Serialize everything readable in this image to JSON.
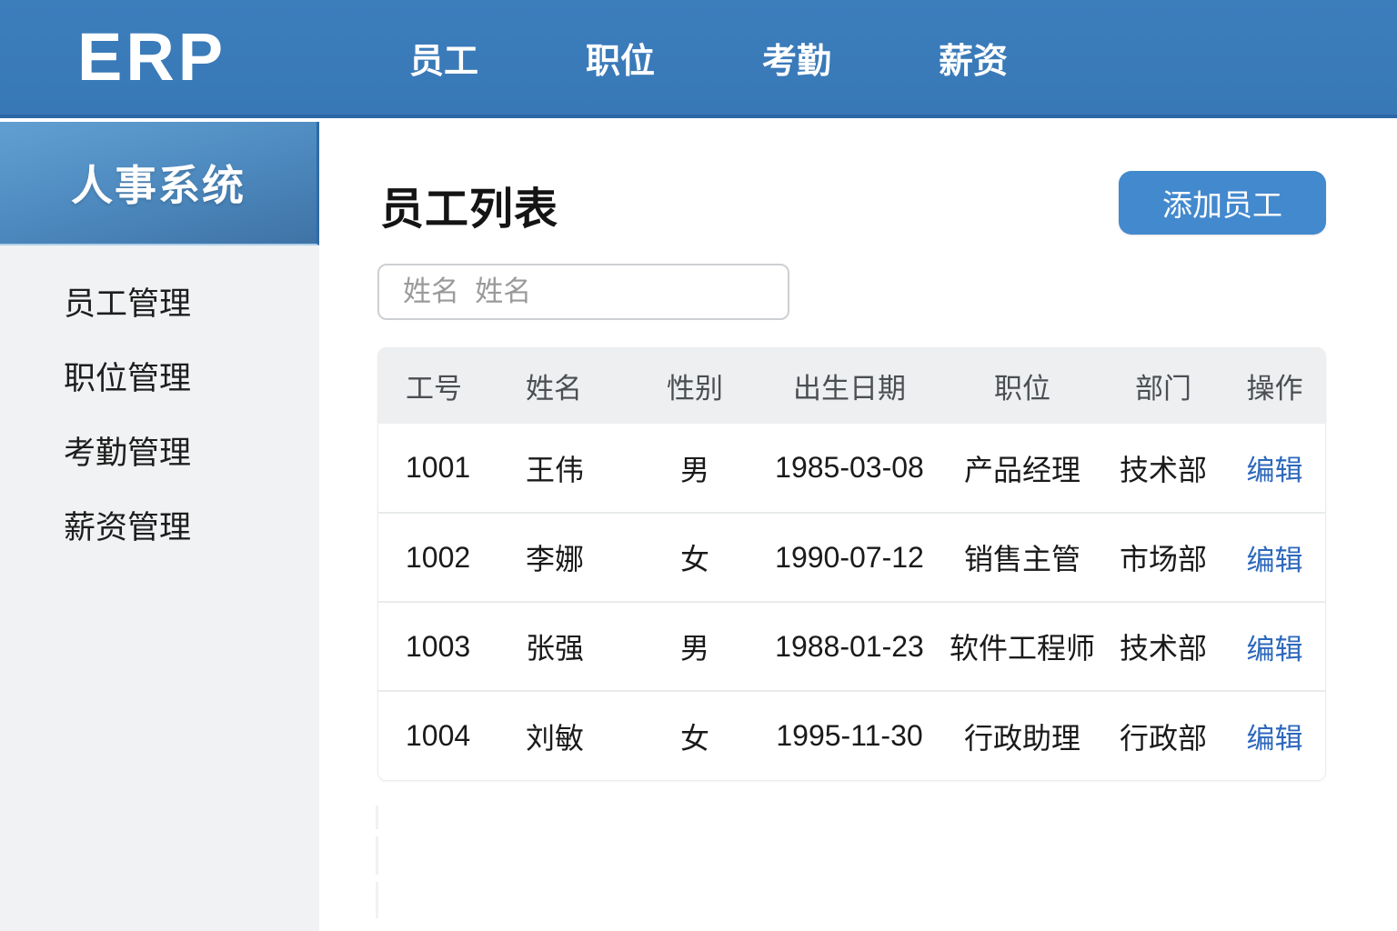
{
  "app": {
    "logo": "ERP"
  },
  "topnav": {
    "items": [
      "员工",
      "职位",
      "考勤",
      "薪资"
    ]
  },
  "sidebar": {
    "title": "人事系统",
    "items": [
      "员工管理",
      "职位管理",
      "考勤管理",
      "薪资管理"
    ]
  },
  "main": {
    "title": "员工列表",
    "add_button_label": "添加员工",
    "search": {
      "placeholder": "姓名  姓名",
      "value": ""
    },
    "table": {
      "columns": [
        "工号",
        "姓名",
        "性别",
        "出生日期",
        "职位",
        "部门",
        "操作"
      ],
      "rows": [
        {
          "id": "1001",
          "name": "王伟",
          "gender": "男",
          "birth": "1985-03-08",
          "position": "产品经理",
          "department": "技术部",
          "action": "编辑"
        },
        {
          "id": "1002",
          "name": "李娜",
          "gender": "女",
          "birth": "1990-07-12",
          "position": "销售主管",
          "department": "市场部",
          "action": "编辑"
        },
        {
          "id": "1003",
          "name": "张强",
          "gender": "男",
          "birth": "1988-01-23",
          "position": "软件工程师",
          "department": "技术部",
          "action": "编辑"
        },
        {
          "id": "1004",
          "name": "刘敏",
          "gender": "女",
          "birth": "1995-11-30",
          "position": "行政助理",
          "department": "行政部",
          "action": "编辑"
        }
      ]
    }
  },
  "colors": {
    "navbar_blue": "#3a7ab9",
    "navbar_border": "#2a68a6",
    "sidebar_header_top": "#619fd2",
    "sidebar_header_bottom": "#3f73a6",
    "sidebar_bg": "#f0f2f3",
    "button_blue": "#4389ce",
    "edit_link_blue": "#2d68bc",
    "table_header_bg": "#edeff0",
    "row_divider": "#e9ebec"
  }
}
